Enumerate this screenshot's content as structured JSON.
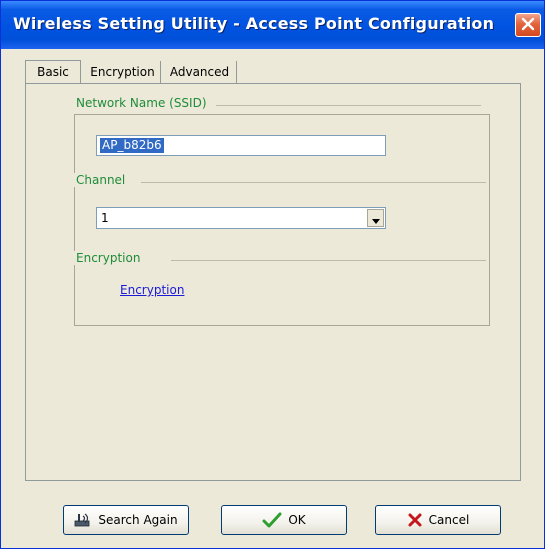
{
  "window": {
    "title": "Wireless Setting Utility - Access Point Configuration"
  },
  "tabs": [
    {
      "label": "Basic",
      "active": true
    },
    {
      "label": "Encryption",
      "active": false
    },
    {
      "label": "Advanced",
      "active": false
    }
  ],
  "network_name": {
    "label": "Network Name (SSID)",
    "value": "AP_b82b6"
  },
  "channel": {
    "label": "Channel",
    "selected": "1"
  },
  "encryption": {
    "label": "Encryption",
    "link_text": "Encryption"
  },
  "buttons": {
    "search_again": "Search Again",
    "ok": "OK",
    "cancel": "Cancel"
  },
  "colors": {
    "title_bar": "#0053e1",
    "section_label": "#1e8c3a",
    "link": "#1a1ad8",
    "selection": "#316ac5"
  },
  "icons": {
    "close": "close-icon",
    "search": "search-signal-icon",
    "ok": "checkmark-icon",
    "cancel": "x-icon",
    "dropdown": "chevron-down-icon"
  }
}
